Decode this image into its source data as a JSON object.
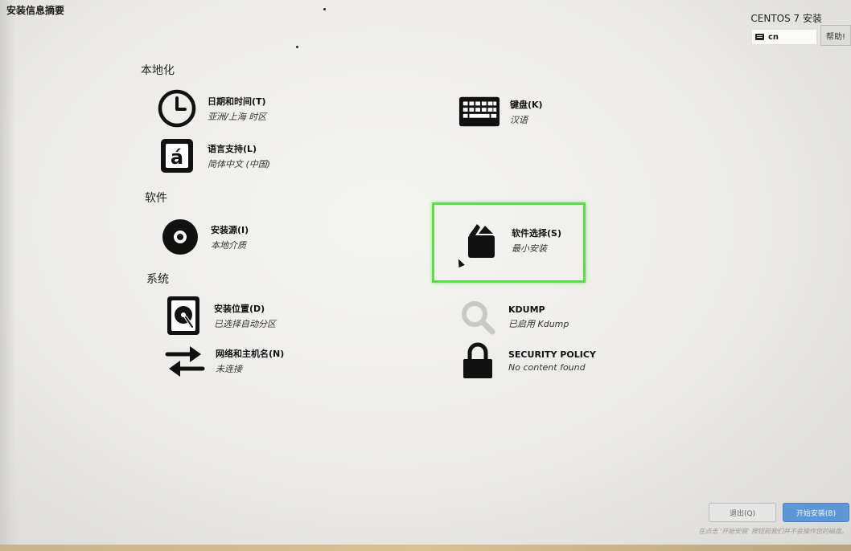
{
  "header": {
    "title": "安装信息摘要",
    "product": "CENTOS 7 安装",
    "language_code": "cn",
    "help_label": "帮助!"
  },
  "sections": {
    "localization": "本地化",
    "software": "软件",
    "system": "系统"
  },
  "spokes": {
    "datetime": {
      "name": "日期和时间(T)",
      "status": "亚洲/上海 时区"
    },
    "keyboard": {
      "name": "键盘(K)",
      "status": "汉语"
    },
    "language": {
      "name": "语言支持(L)",
      "status": "简体中文 (中国)"
    },
    "source": {
      "name": "安装源(I)",
      "status": "本地介质"
    },
    "software_selection": {
      "name": "软件选择(S)",
      "status": "最小安装"
    },
    "destination": {
      "name": "安装位置(D)",
      "status": "已选择自动分区"
    },
    "kdump": {
      "name": "KDUMP",
      "status": "已启用 Kdump"
    },
    "network": {
      "name": "网络和主机名(N)",
      "status": "未连接"
    },
    "security": {
      "name": "SECURITY POLICY",
      "status": "No content found"
    }
  },
  "footer": {
    "quit_label": "退出(Q)",
    "begin_label": "开始安装(B)",
    "hint": "在点击 '开始安装' 按钮前我们并不会操作您的磁盘。"
  },
  "colors": {
    "highlight": "#5cdc4a",
    "primary_button": "#5d97d6"
  }
}
